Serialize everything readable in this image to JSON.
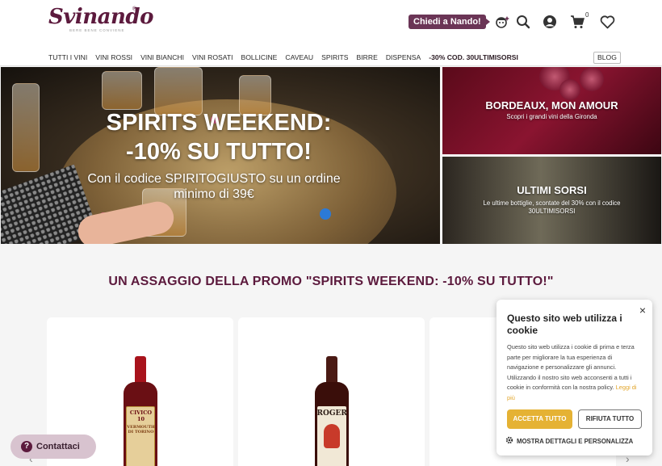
{
  "header": {
    "logo_text": "Svinando",
    "logo_reg": "®",
    "logo_tagline": "BERE BENE CONVIENE",
    "ask_button": "Chiedi a Nando!",
    "cart_count": "0",
    "icons": [
      "nando-avatar-icon",
      "search-icon",
      "account-icon",
      "cart-icon",
      "wishlist-heart-icon"
    ]
  },
  "nav": {
    "items": [
      "TUTTI I VINI",
      "VINI ROSSI",
      "VINI BIANCHI",
      "VINI ROSATI",
      "BOLLICINE",
      "CAVEAU",
      "SPIRITS",
      "BIRRE",
      "DISPENSA",
      "-30% COD. 30ULTIMISORSI"
    ],
    "blog": "BLOG"
  },
  "hero": {
    "main": {
      "line1": "SPIRITS WEEKEND:",
      "line2": "-10% SU TUTTO!",
      "subtitle": "Con il codice SPIRITOGIUSTO su un ordine minimo di 39€"
    },
    "side1": {
      "title": "BORDEAUX, MON AMOUR",
      "subtitle": "Scopri i grandi vini della Gironda"
    },
    "side2": {
      "title": "ULTIMI SORSI",
      "subtitle": "Le ultime bottiglie, scontate del 30% con il codice 30ULTIMISORSI"
    }
  },
  "section": {
    "title": "UN ASSAGGIO DELLA PROMO \"SPIRITS WEEKEND: -10% SU TUTTO!\""
  },
  "products": [
    {
      "label_top": "CIVICO 10",
      "label_mid": "VERMOUTH DI TORINO"
    },
    {
      "label_top": "ROGER",
      "label_mid": ""
    },
    {
      "label_top": "",
      "label_mid": ""
    }
  ],
  "cookie": {
    "title": "Questo sito web utilizza i cookie",
    "body": "Questo sito web utilizza i cookie di prima e terza parte per migliorare la tua esperienza di navigazione e personalizzare gli annunci. Utilizzando il nostro sito web acconsenti a tutti i cookie in conformità con la nostra policy.",
    "more": "Leggi di più",
    "accept": "ACCETTA TUTTO",
    "reject": "RIFIUTA TUTTO",
    "details": "MOSTRA DETTAGLI E PERSONALIZZA",
    "close": "×"
  },
  "contact": {
    "label": "Contattaci"
  }
}
